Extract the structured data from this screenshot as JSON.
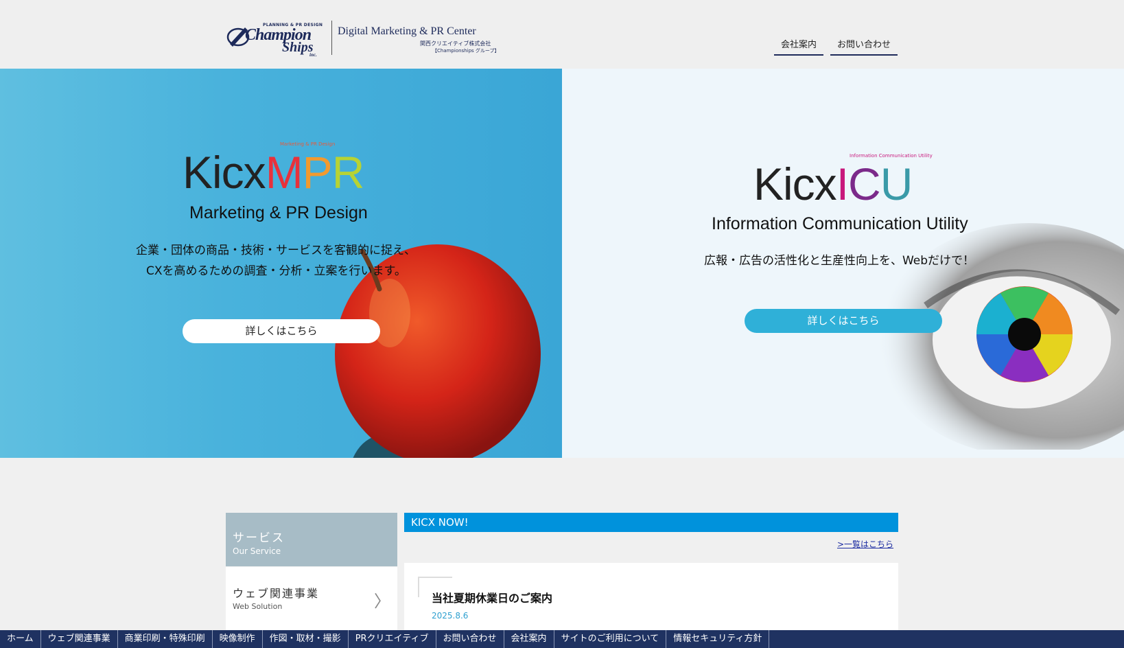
{
  "header": {
    "logo": {
      "small": "PLANNING & PR DESIGN",
      "line1": "Champion",
      "line2": "Ships",
      "inc": "inc.",
      "title": "Digital Marketing & PR Center",
      "jp": "関西クリエイティブ株式会社",
      "jp2": "【Championships グループ】"
    },
    "nav": [
      {
        "label": "会社案内"
      },
      {
        "label": "お問い合わせ"
      }
    ]
  },
  "hero_left": {
    "small": "Marketing & PR Design",
    "brand_prefix": "Kicx",
    "brand_letters": [
      "M",
      "P",
      "R"
    ],
    "brand_colors": [
      "#e8313b",
      "#f29a2e",
      "#b7d334"
    ],
    "subtitle": "Marketing & PR Design",
    "text1": "企業・団体の商品・技術・サービスを客観的に捉え、",
    "text2": "CXを高めるための調査・分析・立案を行います。",
    "button": "詳しくはこちら"
  },
  "hero_right": {
    "small": "Information Communication Utility",
    "brand_prefix": "Kicx",
    "brand_letters": [
      "I",
      "C",
      "U"
    ],
    "brand_colors": [
      "#c8187c",
      "#7b2a8a",
      "#3a9aa8"
    ],
    "subtitle": "Information Communication Utility",
    "text1": "広報・広告の活性化と生産性向上を、Webだけで！",
    "button": "詳しくはこちら"
  },
  "services": {
    "heading": "サービス",
    "heading_en": "Our Service",
    "items": [
      {
        "label": "ウェブ関連事業",
        "label_en": "Web Solution"
      }
    ]
  },
  "news": {
    "bar": "KICX NOW!",
    "link": ">一覧はこちら",
    "items": [
      {
        "title": "当社夏期休業日のご案内",
        "date": "2025.8.6"
      }
    ]
  },
  "bottom_nav": [
    {
      "label": "ホーム"
    },
    {
      "label": "ウェブ関連事業"
    },
    {
      "label": "商業印刷・特殊印刷"
    },
    {
      "label": "映像制作"
    },
    {
      "label": "作図・取材・撮影"
    },
    {
      "label": "PRクリエイティブ"
    },
    {
      "label": "お問い合わせ"
    },
    {
      "label": "会社案内"
    },
    {
      "label": "サイトのご利用について"
    },
    {
      "label": "情報セキュリティ方針"
    }
  ],
  "colors": {
    "navy": "#1f3261",
    "accent_blue": "#0092dc",
    "button_blue": "#2fb0d8"
  }
}
